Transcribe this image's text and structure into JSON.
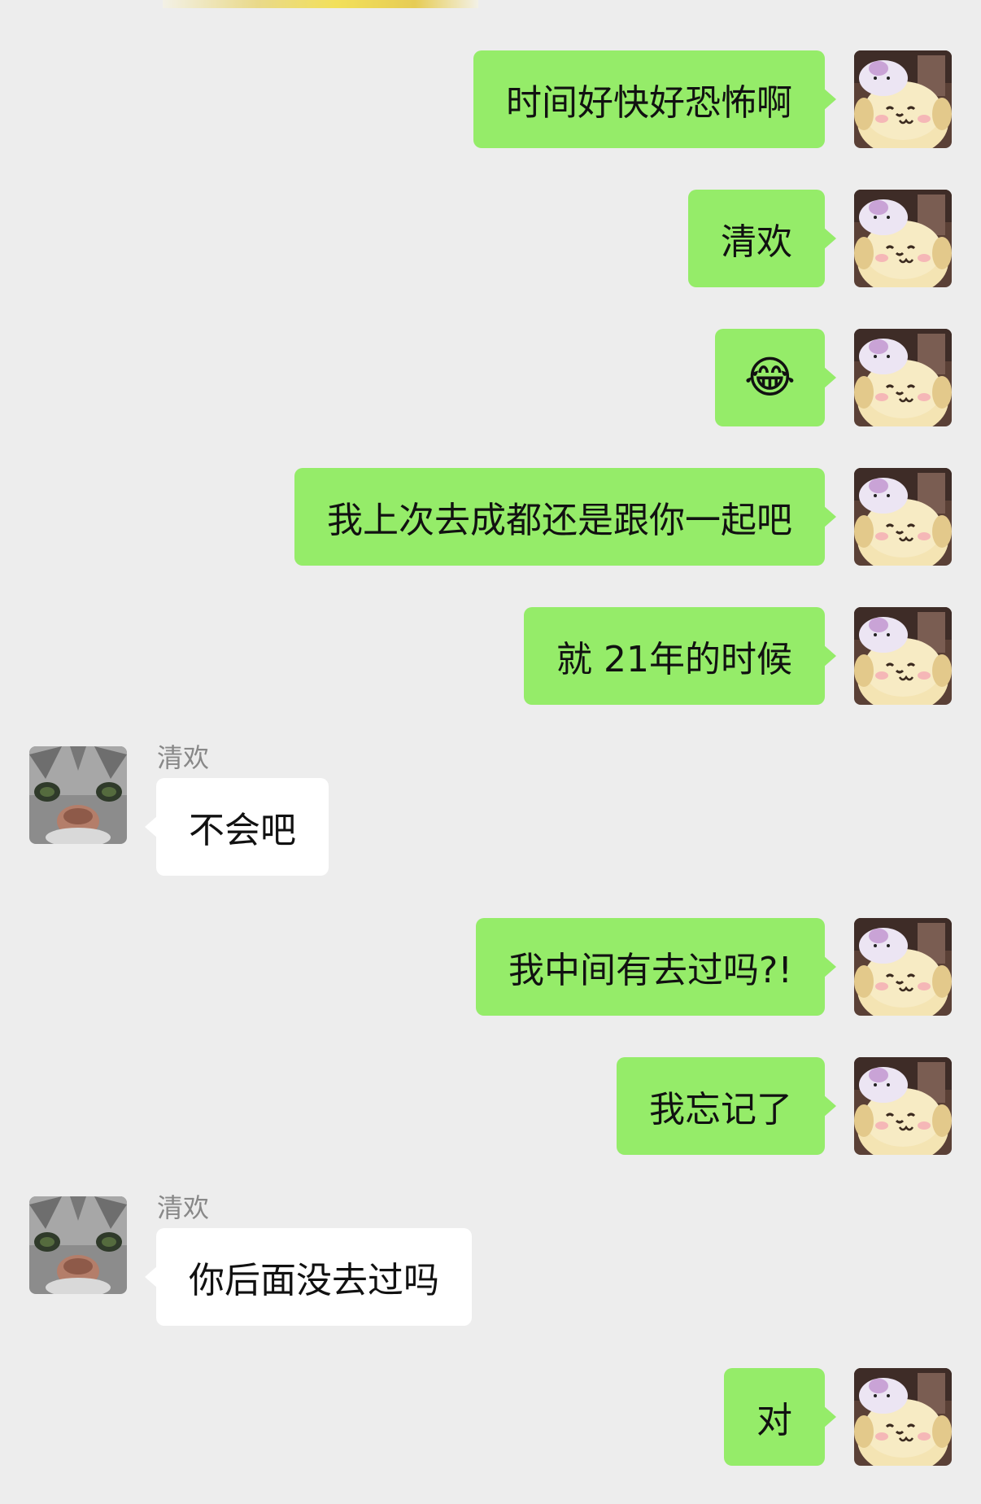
{
  "chat": {
    "contact_name": "清欢",
    "messages": [
      {
        "from": "self",
        "text": "时间好快好恐怖啊"
      },
      {
        "from": "self",
        "text": "清欢"
      },
      {
        "from": "self",
        "text": "😂"
      },
      {
        "from": "self",
        "text": "我上次去成都还是跟你一起吧"
      },
      {
        "from": "self",
        "text": "就 21年的时候"
      },
      {
        "from": "other",
        "sender": "清欢",
        "text": "不会吧"
      },
      {
        "from": "self",
        "text": "我中间有去过吗?!"
      },
      {
        "from": "self",
        "text": "我忘记了"
      },
      {
        "from": "other",
        "sender": "清欢",
        "text": "你后面没去过吗"
      },
      {
        "from": "self",
        "text": "对"
      }
    ]
  },
  "colors": {
    "background": "#ededed",
    "outgoing_bubble": "#95ec69",
    "incoming_bubble": "#ffffff",
    "sender_name": "#888888"
  },
  "icons": {
    "self_avatar": "pompompurin-plush-avatar",
    "other_avatar": "cat-face-avatar"
  }
}
